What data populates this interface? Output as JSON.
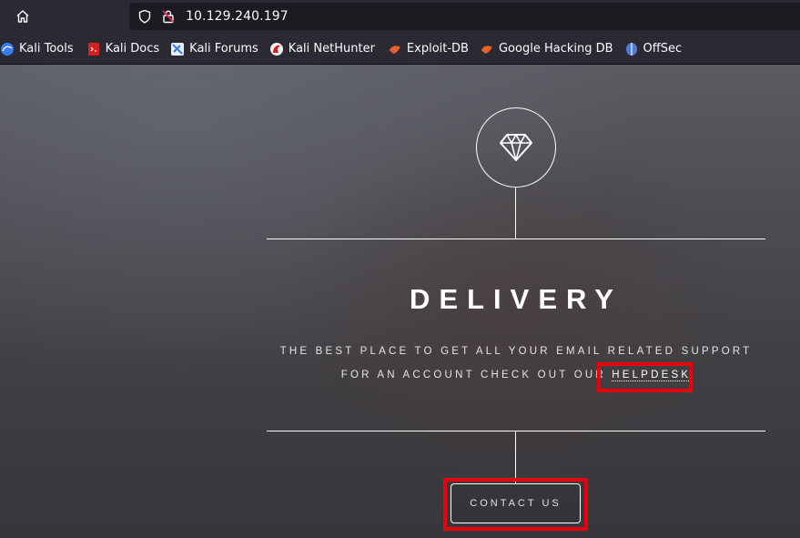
{
  "browser": {
    "url": "10.129.240.197",
    "bookmarks": [
      {
        "label": "Kali Tools",
        "icon": "kali-tools-icon",
        "color": "#367bf0"
      },
      {
        "label": "Kali Docs",
        "icon": "kali-docs-icon",
        "color": "#d81e1e"
      },
      {
        "label": "Kali Forums",
        "icon": "kali-forums-icon",
        "color": "#367bf0"
      },
      {
        "label": "Kali NetHunter",
        "icon": "kali-nethunter-icon",
        "color": "#d81e1e"
      },
      {
        "label": "Exploit-DB",
        "icon": "exploit-db-icon",
        "color": "#e8602c"
      },
      {
        "label": "Google Hacking DB",
        "icon": "google-hacking-db-icon",
        "color": "#e8602c"
      },
      {
        "label": "OffSec",
        "icon": "offsec-icon",
        "color": "#4f7bd9"
      }
    ]
  },
  "site": {
    "logo_icon": "diamond-icon",
    "title": "DELIVERY",
    "tagline_line1": "THE BEST PLACE TO GET ALL YOUR EMAIL RELATED SUPPORT",
    "tagline_line2_prefix": "FOR AN ACCOUNT CHECK OUT OUR ",
    "helpdesk_link": "HELPDESK",
    "contact_button": "CONTACT US"
  },
  "annotations": {
    "highlight_color": "#e8000c"
  }
}
